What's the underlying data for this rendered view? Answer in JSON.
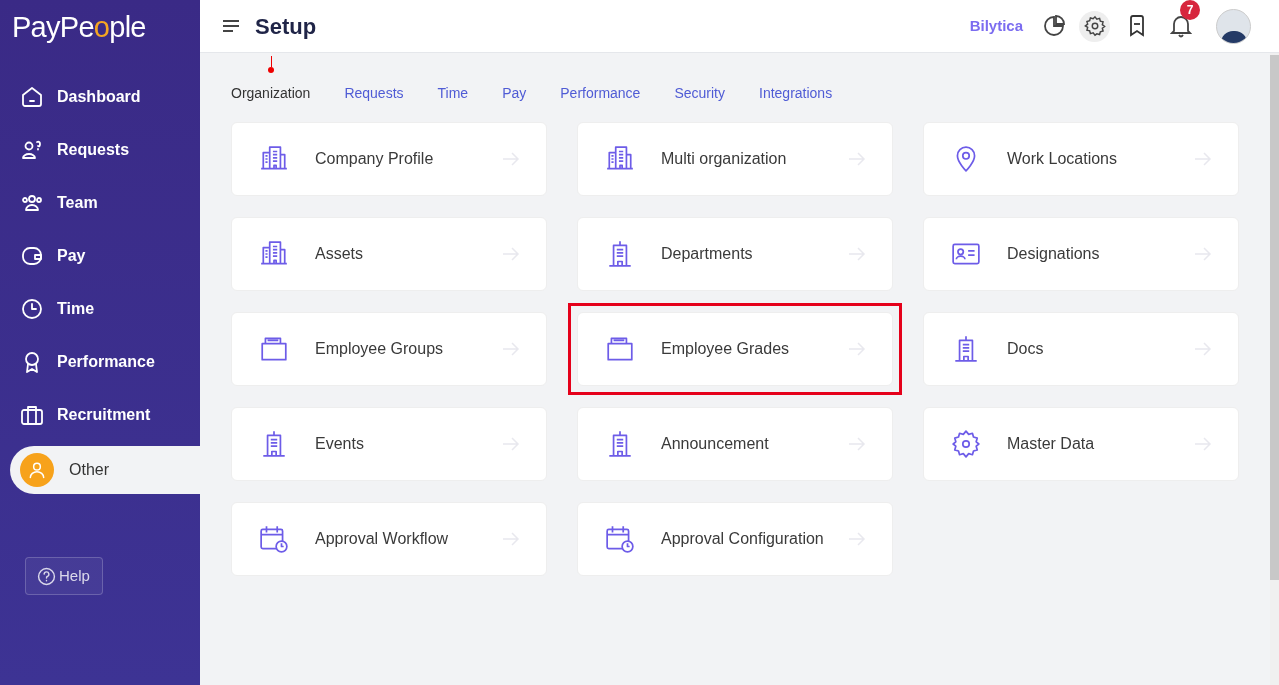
{
  "brand": {
    "logo_start": "PayPe",
    "logo_o": "o",
    "logo_end": "ple"
  },
  "sidebar": {
    "items": [
      {
        "label": "Dashboard",
        "kind": "home",
        "selected": false
      },
      {
        "label": "Requests",
        "kind": "request",
        "selected": false
      },
      {
        "label": "Team",
        "kind": "team",
        "selected": false
      },
      {
        "label": "Pay",
        "kind": "wallet",
        "selected": false
      },
      {
        "label": "Time",
        "kind": "clock",
        "selected": false
      },
      {
        "label": "Performance",
        "kind": "award",
        "selected": false
      },
      {
        "label": "Recruitment",
        "kind": "briefcase",
        "selected": false
      },
      {
        "label": "Other",
        "kind": "user",
        "selected": true
      }
    ],
    "help": "Help"
  },
  "header": {
    "title": "Setup",
    "company": "Bilytica",
    "notifications": "7"
  },
  "tabs": [
    {
      "label": "Organization",
      "selected": true
    },
    {
      "label": "Requests",
      "selected": false
    },
    {
      "label": "Time",
      "selected": false
    },
    {
      "label": "Pay",
      "selected": false
    },
    {
      "label": "Performance",
      "selected": false
    },
    {
      "label": "Security",
      "selected": false
    },
    {
      "label": "Integrations",
      "selected": false
    }
  ],
  "cards": [
    {
      "label": "Company Profile",
      "kind": "buildings",
      "highlighted": false
    },
    {
      "label": "Multi organization",
      "kind": "buildings",
      "highlighted": false
    },
    {
      "label": "Work Locations",
      "kind": "pin",
      "highlighted": false
    },
    {
      "label": "Assets",
      "kind": "buildings",
      "highlighted": false
    },
    {
      "label": "Departments",
      "kind": "tower",
      "highlighted": false
    },
    {
      "label": "Designations",
      "kind": "idcard",
      "highlighted": false
    },
    {
      "label": "Employee Groups",
      "kind": "folder",
      "highlighted": false
    },
    {
      "label": "Employee Grades",
      "kind": "folder",
      "highlighted": true
    },
    {
      "label": "Docs",
      "kind": "tower",
      "highlighted": false
    },
    {
      "label": "Events",
      "kind": "tower",
      "highlighted": false
    },
    {
      "label": "Announcement",
      "kind": "tower",
      "highlighted": false
    },
    {
      "label": "Master Data",
      "kind": "gear",
      "highlighted": false
    },
    {
      "label": "Approval Workflow",
      "kind": "calendar",
      "highlighted": false
    },
    {
      "label": "Approval Configuration",
      "kind": "calendar",
      "highlighted": false
    }
  ]
}
